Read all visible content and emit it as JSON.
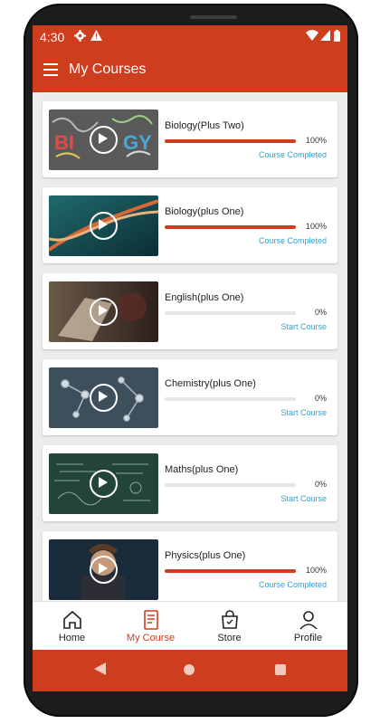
{
  "status_bar": {
    "time": "4:30",
    "icons": [
      "settings-icon",
      "warning-icon",
      "wifi-icon",
      "signal-icon",
      "battery-icon"
    ]
  },
  "toolbar": {
    "title": "My Courses",
    "menu_icon": "menu-icon"
  },
  "courses": [
    {
      "title": "Biology(Plus Two)",
      "progress": 100,
      "percent_label": "100%",
      "status": "Course Completed"
    },
    {
      "title": "Biology(plus One)",
      "progress": 100,
      "percent_label": "100%",
      "status": "Course Completed"
    },
    {
      "title": "English(plus One)",
      "progress": 0,
      "percent_label": "0%",
      "status": "Start Course"
    },
    {
      "title": "Chemistry(plus One)",
      "progress": 0,
      "percent_label": "0%",
      "status": "Start Course"
    },
    {
      "title": "Maths(plus One)",
      "progress": 0,
      "percent_label": "0%",
      "status": "Start Course"
    },
    {
      "title": "Physics(plus One)",
      "progress": 100,
      "percent_label": "100%",
      "status": "Course Completed"
    }
  ],
  "bottom_nav": [
    {
      "label": "Home",
      "icon": "home-icon",
      "active": false
    },
    {
      "label": "My Course",
      "icon": "course-icon",
      "active": true
    },
    {
      "label": "Store",
      "icon": "store-icon",
      "active": false
    },
    {
      "label": "Profile",
      "icon": "profile-icon",
      "active": false
    }
  ],
  "colors": {
    "primary": "#cf3d1f",
    "link": "#2ea0d4",
    "background": "#ececec"
  }
}
